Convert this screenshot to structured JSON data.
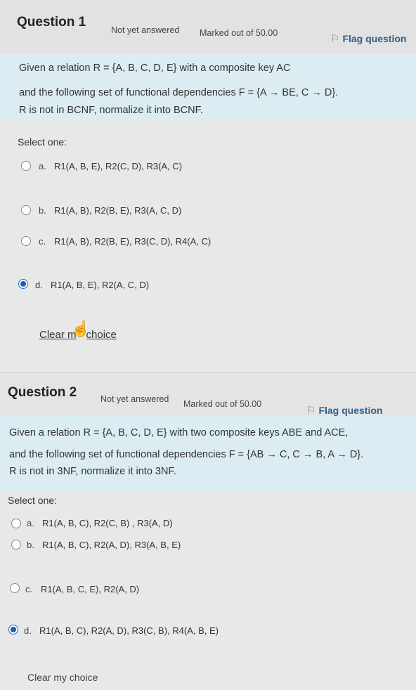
{
  "q1": {
    "title": "Question 1",
    "status": "Not yet answered",
    "marks": "Marked out of 50.00",
    "flag_label": "Flag question",
    "text_lines": [
      "Given a relation R = {A, B, C, D, E} with a composite key AC",
      "and the following set of functional dependencies F = {A → BE, C → D}.",
      "R is not in BCNF, normalize it into BCNF."
    ],
    "select_one": "Select one:",
    "options": [
      {
        "letter": "a.",
        "text": "R1(A, B, E), R2(C, D), R3(A, C)",
        "selected": false
      },
      {
        "letter": "b.",
        "text": "R1(A, B), R2(B, E), R3(A, C, D)",
        "selected": false
      },
      {
        "letter": "c.",
        "text": "R1(A, B), R2(B, E), R3(C, D), R4(A, C)",
        "selected": false
      },
      {
        "letter": "d.",
        "text": "R1(A, B, E), R2(A, C, D)",
        "selected": true
      }
    ],
    "clear_part1": "Clear m",
    "clear_part2": "choice"
  },
  "q2": {
    "title": "Question 2",
    "status": "Not yet answered",
    "marks": "Marked out of 50.00",
    "flag_label": "Flag question",
    "text_lines": [
      "Given a relation R = {A, B, C, D, E} with two composite keys ABE and ACE,",
      "and the following set of functional dependencies F = {AB → C, C → B, A → D}.",
      "R is not in 3NF, normalize it into 3NF."
    ],
    "select_one": "Select one:",
    "options": [
      {
        "letter": "a.",
        "text": "R1(A, B, C), R2(C, B) , R3(A, D)",
        "selected": false
      },
      {
        "letter": "b.",
        "text": "R1(A, B, C), R2(A, D), R3(A, B, E)",
        "selected": false
      },
      {
        "letter": "c.",
        "text": "R1(A, B, C, E), R2(A, D)",
        "selected": false
      },
      {
        "letter": "d.",
        "text": "R1(A, B, C), R2(A, D), R3(C, B), R4(A, B, E)",
        "selected": true
      }
    ],
    "clear": "Clear my choice"
  },
  "icons": {
    "flag": "flag-icon",
    "cursor": "hand-pointer-icon"
  },
  "colors": {
    "selected_radio": "#1a5fb0",
    "question_text_bg": "#dcecf3"
  }
}
